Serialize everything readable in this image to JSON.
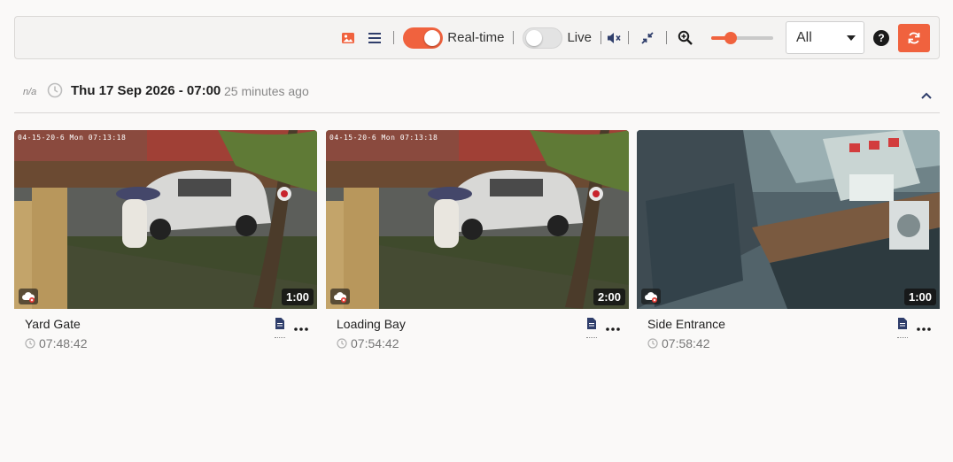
{
  "toolbar": {
    "realtime_label": "Real-time",
    "realtime_on": true,
    "live_label": "Live",
    "live_on": false,
    "zoom_level": 0.32,
    "filter_value": "All",
    "help_label": "?",
    "accent_color": "#f0623e"
  },
  "event": {
    "na_label": "n/a",
    "date": "Thu 17 Sep 2026 - 07:00",
    "ago": "25 minutes ago"
  },
  "cards": [
    {
      "name": "Yard Gate",
      "time": "07:48:42",
      "duration": "1:00",
      "osd": "04-15-20-6 Mon 07:13:18"
    },
    {
      "name": "Loading Bay",
      "time": "07:54:42",
      "duration": "2:00",
      "osd": "04-15-20-6 Mon 07:13:18"
    },
    {
      "name": "Side Entrance",
      "time": "07:58:42",
      "duration": "1:00",
      "osd": ""
    }
  ]
}
